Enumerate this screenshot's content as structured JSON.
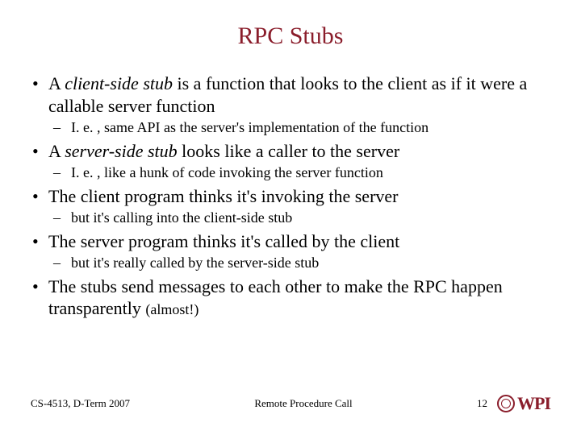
{
  "title": "RPC Stubs",
  "bullets": {
    "b1": {
      "pre": "A ",
      "em": "client-side stub",
      "post": " is a function that looks to the client as if it were a callable server function"
    },
    "s1": "I. e. , same API as the server's implementation of the function",
    "b2": {
      "pre": "A ",
      "em": "server-side stub",
      "post": " looks like a caller to the server"
    },
    "s2": "I. e. , like a hunk of code invoking the server function",
    "b3": "The client program thinks it's invoking the server",
    "s3": "but it's calling into the client-side stub",
    "b4": "The server program thinks it's called by the client",
    "s4": "but it's really called by the server-side stub",
    "b5": {
      "main": "The stubs send messages to each other to make the RPC happen transparently ",
      "tail": "(almost!)"
    }
  },
  "footer": {
    "course": "CS-4513, D-Term 2007",
    "topic": "Remote Procedure Call",
    "page": "12",
    "org": "WPI"
  }
}
